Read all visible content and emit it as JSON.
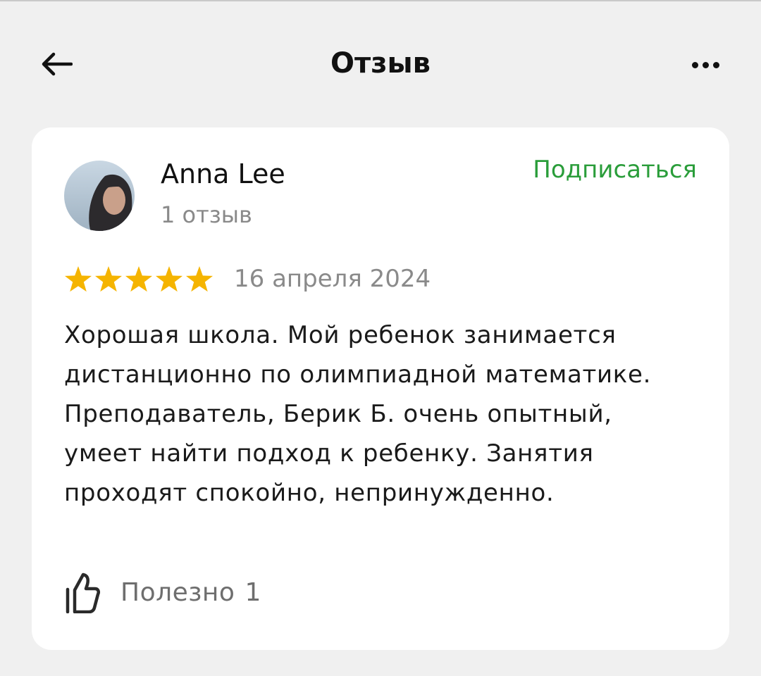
{
  "header": {
    "title": "Отзыв",
    "back_icon": "arrow-left-icon",
    "more_icon": "more-dots-icon"
  },
  "review": {
    "author": {
      "name": "Anna Lee",
      "review_count": "1 отзыв"
    },
    "subscribe_label": "Подписаться",
    "rating": 5,
    "rating_max": 5,
    "date": "16 апреля 2024",
    "text": "Хорошая школа. Мой ребенок занимается дистанционно по олимпиадной математике. Преподаватель, Берик Б. очень опытный, умеет найти подход к ребенку. Занятия проходят спокойно, непринужденно.",
    "helpful": {
      "label": "Полезно",
      "count": "1",
      "icon": "thumbs-up-icon"
    }
  },
  "colors": {
    "background": "#f0f0f0",
    "card": "#ffffff",
    "accent_green": "#2a9d3a",
    "star": "#f5b400",
    "muted_text": "#8a8a8a"
  }
}
